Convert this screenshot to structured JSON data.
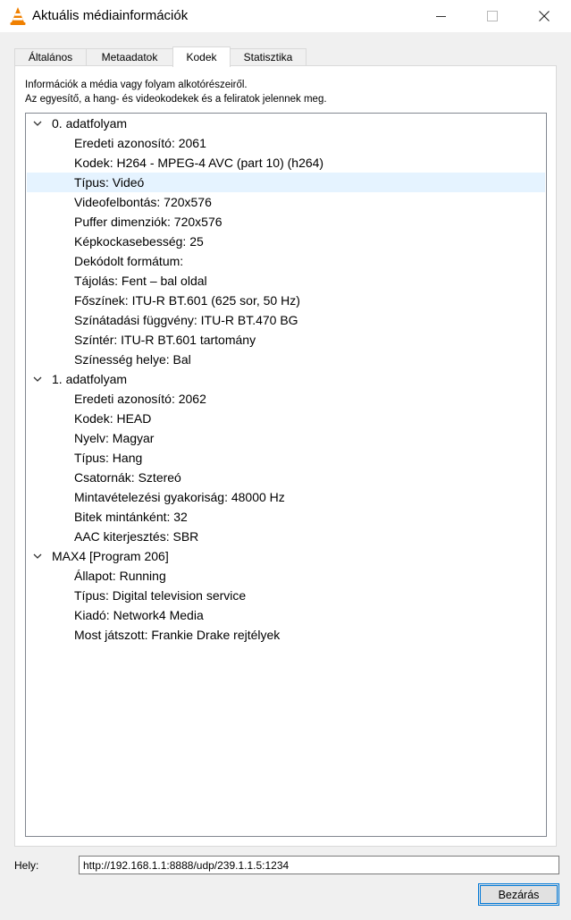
{
  "window": {
    "title": "Aktuális médiainformációk"
  },
  "icons": {
    "app": "vlc-cone-icon",
    "minimize": "minimize-icon",
    "maximize": "maximize-icon",
    "close": "close-icon",
    "expand": "chevron-down-icon"
  },
  "colors": {
    "vlc_orange": "#f08000",
    "selection": "#e5f3ff",
    "accent": "#0078d7"
  },
  "tabs": [
    {
      "label": "Általános"
    },
    {
      "label": "Metaadatok"
    },
    {
      "label": "Kodek"
    },
    {
      "label": "Statisztika"
    }
  ],
  "active_tab": "Kodek",
  "codec": {
    "description_line1": "Információk a média vagy folyam alkotórészeiről.",
    "description_line2": "Az egyesítő, a hang- és videokodekek és a feliratok jelennek meg.",
    "streams": [
      {
        "title": "0. adatfolyam",
        "items": [
          "Eredeti azonosító: 2061",
          "Kodek: H264 - MPEG-4 AVC (part 10) (h264)",
          "Típus: Videó",
          "Videofelbontás: 720x576",
          "Puffer dimenziók: 720x576",
          "Képkockasebesség: 25",
          "Dekódolt formátum:",
          "Tájolás: Fent – bal oldal",
          "Főszínek: ITU-R BT.601 (625 sor, 50 Hz)",
          "Színátadási függvény: ITU-R BT.470 BG",
          "Színtér: ITU-R BT.601 tartomány",
          "Színesség helye: Bal"
        ]
      },
      {
        "title": "1. adatfolyam",
        "items": [
          "Eredeti azonosító: 2062",
          "Kodek: HEAD",
          "Nyelv: Magyar",
          "Típus: Hang",
          "Csatornák: Sztereó",
          "Mintavételezési gyakoriság: 48000 Hz",
          "Bitek mintánként: 32",
          "AAC kiterjesztés: SBR"
        ]
      },
      {
        "title": "MAX4 [Program 206]",
        "items": [
          "Állapot: Running",
          "Típus: Digital television service",
          "Kiadó: Network4 Media",
          "Most játszott: Frankie Drake rejtélyek"
        ]
      }
    ],
    "selected_item": "Típus: Videó"
  },
  "location": {
    "label": "Hely:",
    "value": "http://192.168.1.1:8888/udp/239.1.1.5:1234"
  },
  "close_button": {
    "label": "Bezárás"
  }
}
